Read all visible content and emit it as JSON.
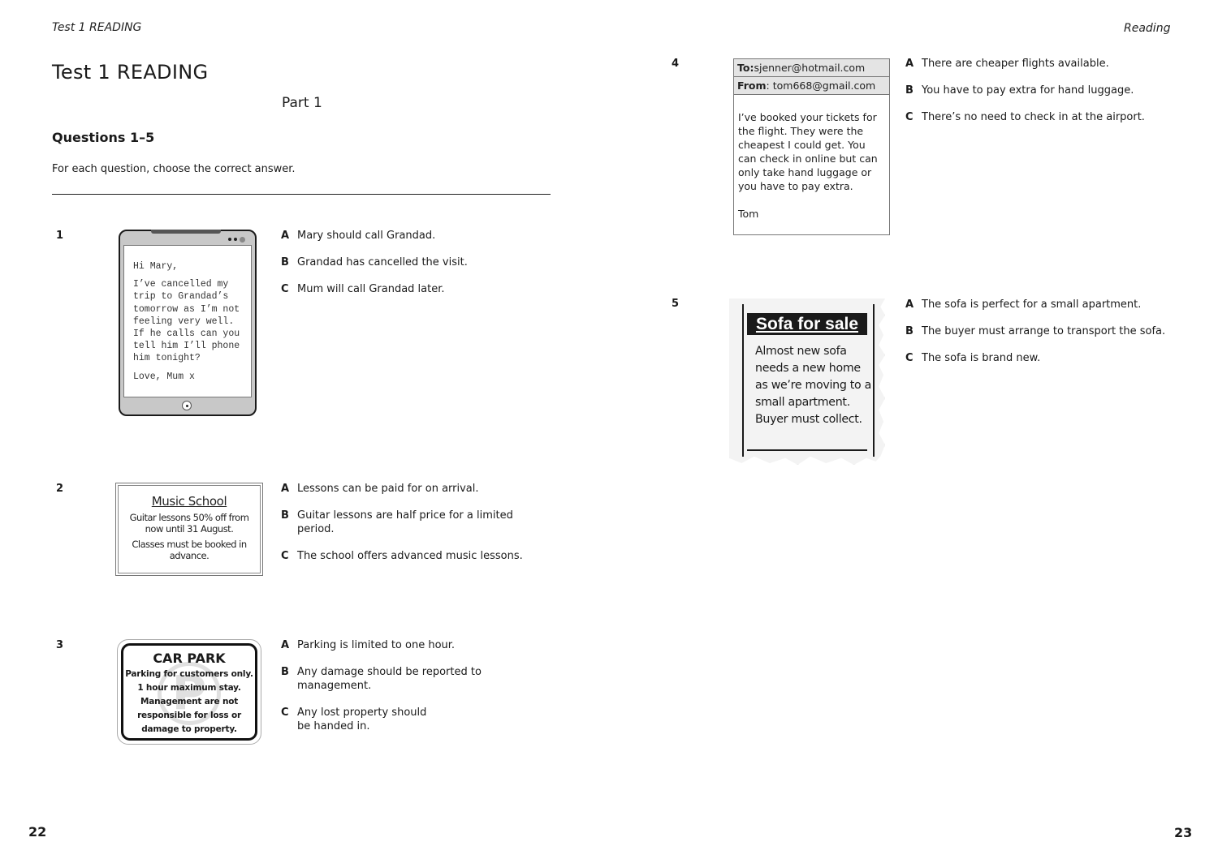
{
  "left_page": {
    "running_head": "Test 1 READING",
    "title": "Test 1 READING",
    "part": "Part 1",
    "questions_heading": "Questions 1–5",
    "instructions": "For each question, choose the correct answer.",
    "page_number": "22"
  },
  "right_page": {
    "running_head": "Reading",
    "page_number": "23"
  },
  "questions": [
    {
      "number": "1",
      "stimulus": {
        "type": "text-message",
        "lines": [
          "Hi Mary,",
          "I’ve cancelled my trip to Grandad’s tomorrow as I’m not feeling very well. If he calls can you tell him I’ll phone him tonight?",
          "Love, Mum x"
        ]
      },
      "options": [
        {
          "letter": "A",
          "text": "Mary should call Grandad."
        },
        {
          "letter": "B",
          "text": "Grandad has cancelled the visit."
        },
        {
          "letter": "C",
          "text": "Mum will call Grandad later."
        }
      ]
    },
    {
      "number": "2",
      "stimulus": {
        "type": "notice",
        "title": "Music School",
        "lines": [
          "Guitar lessons 50% off from now until 31 August.",
          "Classes must be booked in advance."
        ]
      },
      "options": [
        {
          "letter": "A",
          "text": "Lessons can be paid for on arrival."
        },
        {
          "letter": "B",
          "text": "Guitar lessons are half price for a limited period."
        },
        {
          "letter": "C",
          "text": "The school offers advanced music lessons."
        }
      ]
    },
    {
      "number": "3",
      "stimulus": {
        "type": "sign",
        "title": "CAR PARK",
        "watermark": "P",
        "lines": [
          "Parking for customers only.",
          "1 hour maximum stay.",
          "Management are not",
          "responsible for loss or",
          "damage to property."
        ]
      },
      "options": [
        {
          "letter": "A",
          "text": "Parking is limited to one hour."
        },
        {
          "letter": "B",
          "text": "Any damage should be reported to management."
        },
        {
          "letter": "C",
          "text": "Any lost property should be handed in."
        }
      ]
    },
    {
      "number": "4",
      "stimulus": {
        "type": "email",
        "to_label": "To:",
        "to": "sjenner@hotmail.com",
        "from_label": "From",
        "from": ": tom668@gmail.com",
        "body": "I’ve booked your tickets for the flight. They were the cheapest I could get. You can check in online but can only take hand luggage or you have to pay extra.",
        "signature": "Tom"
      },
      "options": [
        {
          "letter": "A",
          "text": "There are cheaper flights available."
        },
        {
          "letter": "B",
          "text": "You have to pay extra for hand luggage."
        },
        {
          "letter": "C",
          "text": "There’s no need to check in at the airport."
        }
      ]
    },
    {
      "number": "5",
      "stimulus": {
        "type": "newspaper-ad",
        "title": "Sofa for sale",
        "body": "Almost new sofa needs a new home as we’re moving to a small apartment. Buyer must collect."
      },
      "options": [
        {
          "letter": "A",
          "text": "The sofa is perfect for a small apartment."
        },
        {
          "letter": "B",
          "text": "The buyer must arrange to transport the sofa."
        },
        {
          "letter": "C",
          "text": "The sofa is brand new."
        }
      ]
    }
  ]
}
